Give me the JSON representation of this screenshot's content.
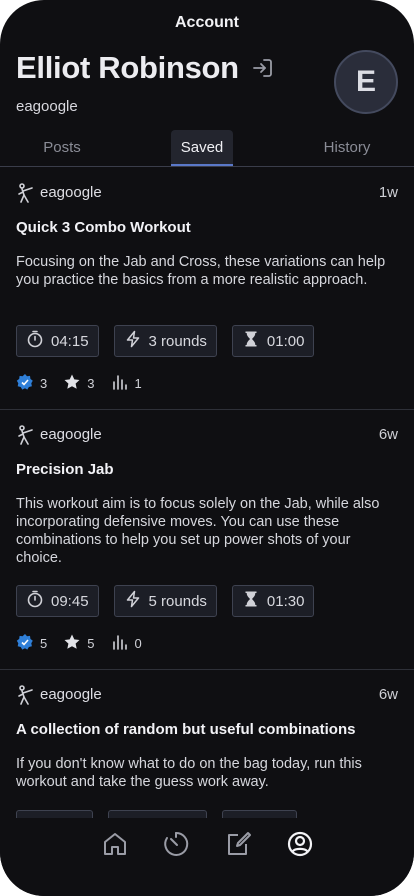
{
  "header": {
    "title": "Account"
  },
  "profile": {
    "name": "Elliot Robinson",
    "handle": "eagoogle",
    "avatar_initial": "E"
  },
  "tabs": [
    {
      "label": "Posts",
      "active": false
    },
    {
      "label": "Saved",
      "active": true
    },
    {
      "label": "History",
      "active": false
    }
  ],
  "posts": [
    {
      "author": "eagoogle",
      "age": "1w",
      "title": "Quick 3 Combo Workout",
      "description": "Focusing on the Jab and Cross, these variations can help you practice the basics from a more realistic approach.",
      "duration": "04:15",
      "rounds": "3 rounds",
      "rest": "01:00",
      "likes": "3",
      "stars": "3",
      "views": "1"
    },
    {
      "author": "eagoogle",
      "age": "6w",
      "title": "Precision Jab",
      "description": "This workout aim is to focus solely on the Jab, while also incorporating defensive moves. You can use these combinations to help you set up power shots of your choice.",
      "duration": "09:45",
      "rounds": "5 rounds",
      "rest": "01:30",
      "likes": "5",
      "stars": "5",
      "views": "0"
    },
    {
      "author": "eagoogle",
      "age": "6w",
      "title": "A collection of random but useful combinations",
      "description": "If you don't know what to do on the bag today, run this workout and take the guess work away."
    }
  ],
  "nav": [
    "home-icon",
    "timer-icon",
    "edit-icon",
    "account-icon"
  ],
  "colors": {
    "background": "#0f0f12",
    "accent": "#3a8ee6",
    "tab_indicator": "#5a78c8"
  }
}
